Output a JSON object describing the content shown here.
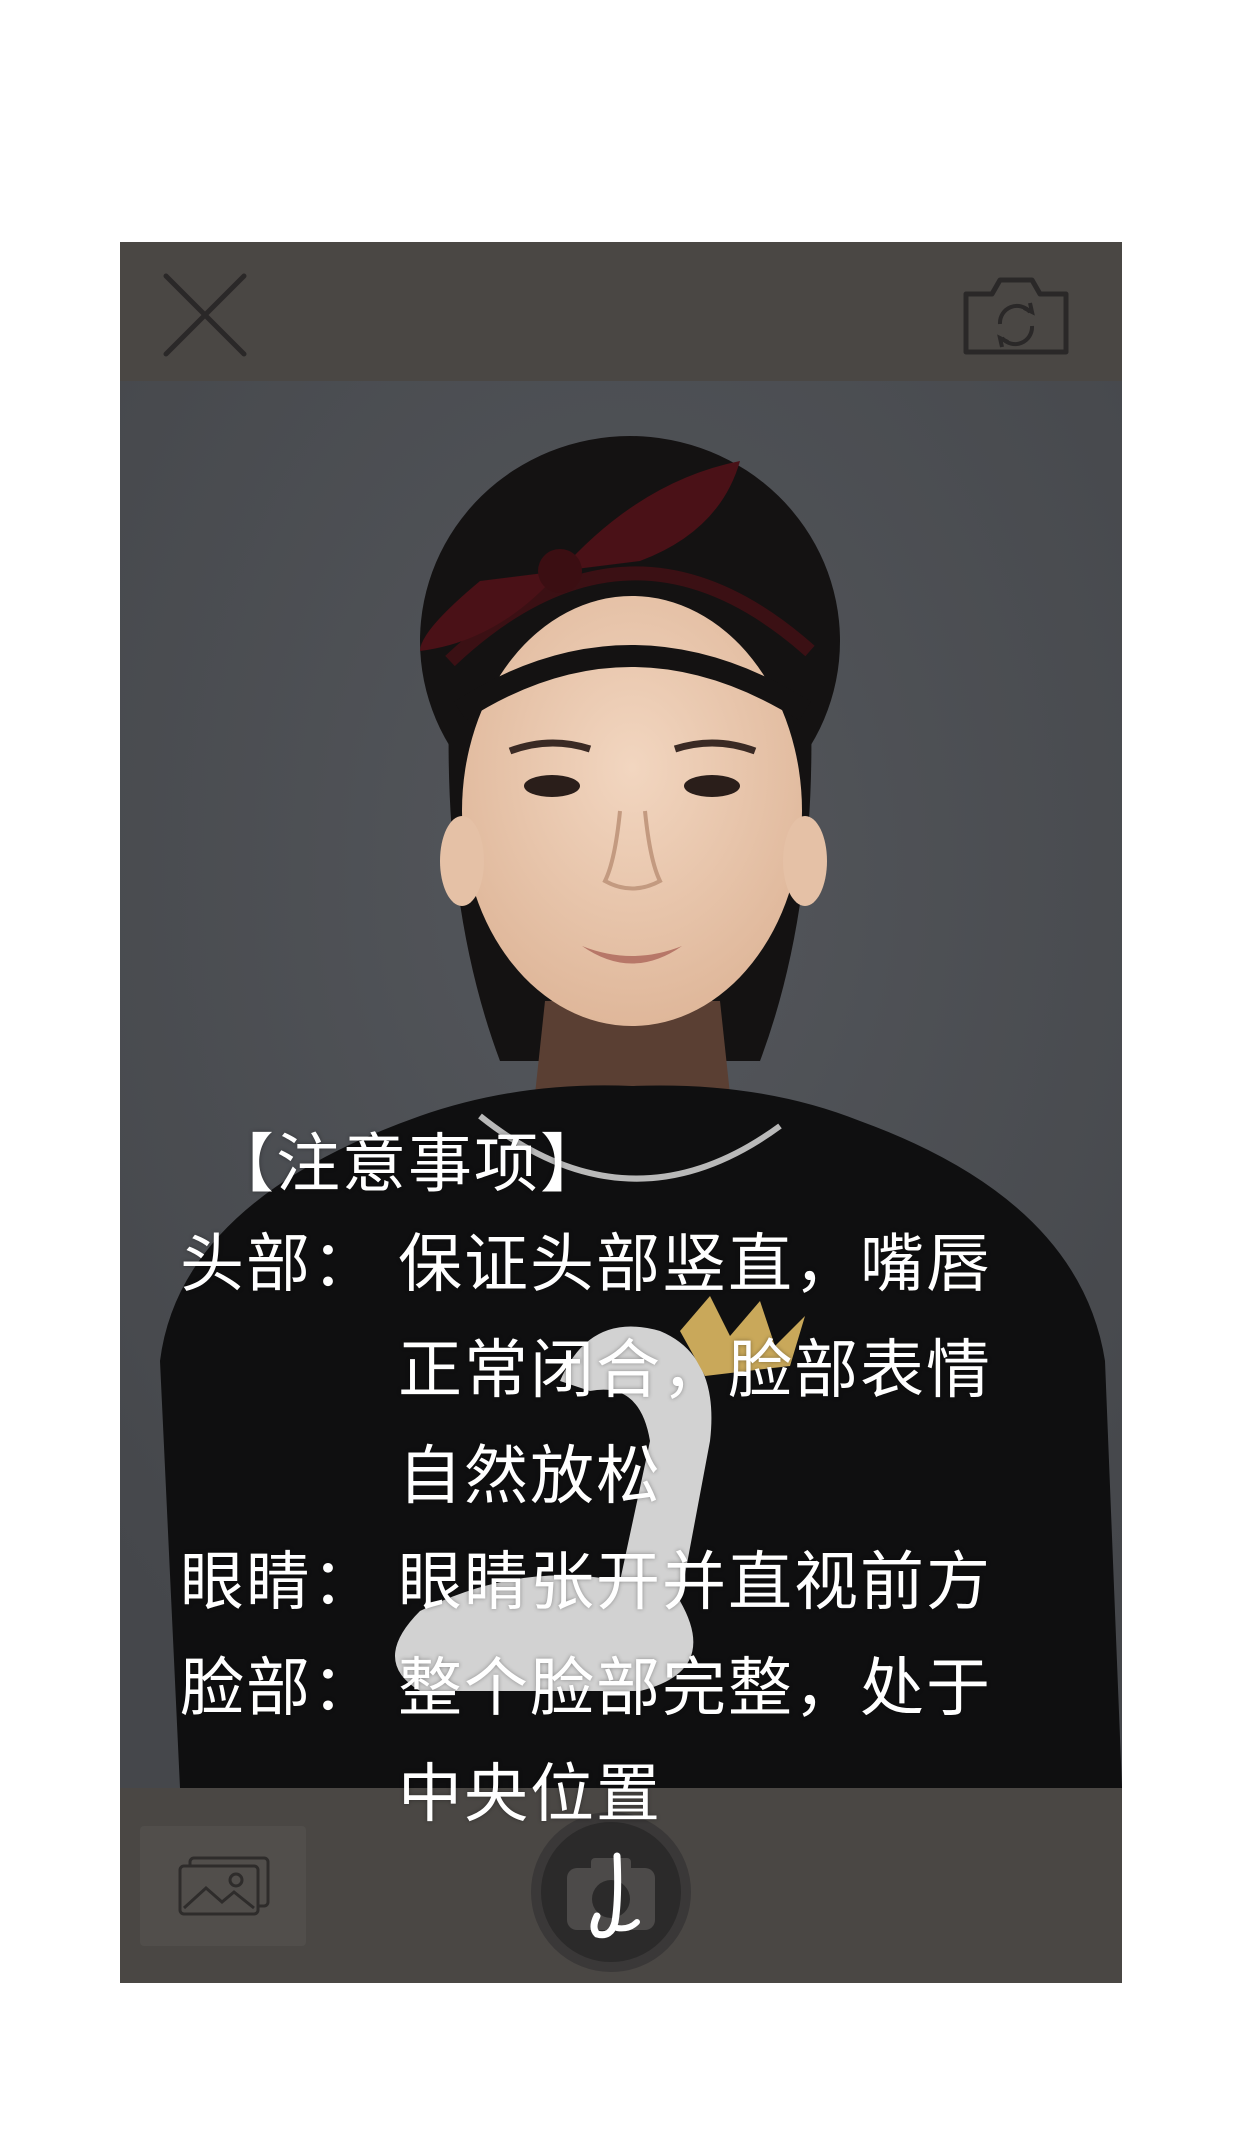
{
  "colors": {
    "bar_background": "#4a4744",
    "viewfinder_background": "#4d5055",
    "note_text": "#ffffff",
    "page_background": "#ffffff"
  },
  "top_bar": {
    "close_icon": "close-icon",
    "switch_camera_icon": "camera-switch-icon"
  },
  "bottom_bar": {
    "gallery_icon": "gallery-icon",
    "shutter_icon": "camera-shutter-icon"
  },
  "notes": {
    "title": "【注意事项】",
    "items": [
      {
        "label": "头部：",
        "text": "保证头部竖直，嘴唇正常闭合，脸部表情自然放松"
      },
      {
        "label": "眼睛：",
        "text": "眼睛张开并直视前方"
      },
      {
        "label": "脸部：",
        "text": "整个脸部完整，处于中央位置"
      }
    ]
  }
}
